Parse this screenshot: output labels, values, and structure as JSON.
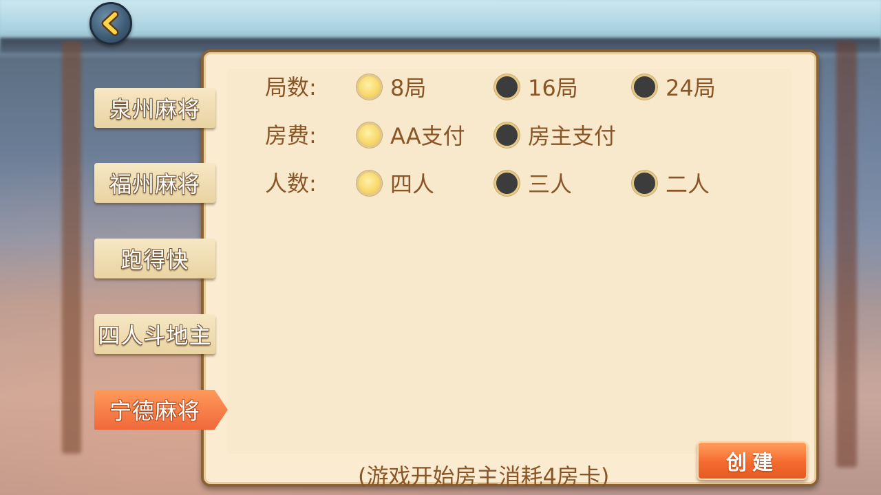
{
  "tabs": [
    {
      "label": "泉州麻将",
      "active": false
    },
    {
      "label": "福州麻将",
      "active": false
    },
    {
      "label": "跑得快",
      "active": false
    },
    {
      "label": "四人斗地主",
      "active": false
    },
    {
      "label": "宁德麻将",
      "active": true
    }
  ],
  "rows": [
    {
      "label": "局数:",
      "options": [
        {
          "label": "8局",
          "selected": true
        },
        {
          "label": "16局",
          "selected": false
        },
        {
          "label": "24局",
          "selected": false
        }
      ]
    },
    {
      "label": "房费:",
      "options": [
        {
          "label": "AA支付",
          "selected": true
        },
        {
          "label": "房主支付",
          "selected": false
        }
      ]
    },
    {
      "label": "人数:",
      "options": [
        {
          "label": "四人",
          "selected": true
        },
        {
          "label": "三人",
          "selected": false
        },
        {
          "label": "二人",
          "selected": false
        }
      ]
    }
  ],
  "footer_note": "(游戏开始房主消耗4房卡)",
  "create_label": "创建",
  "icons": {
    "back": "chevron-left-icon"
  },
  "colors": {
    "accent": "#f46b30",
    "text": "#8a5526",
    "panel": "#fbecd1",
    "radio_on": "#f8d86a",
    "radio_off": "#3c3c3c"
  }
}
